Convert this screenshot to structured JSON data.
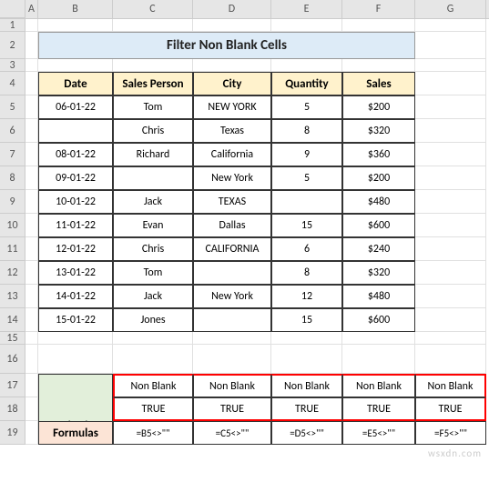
{
  "columns": [
    "A",
    "B",
    "C",
    "D",
    "E",
    "F",
    "G"
  ],
  "rowNumbers": [
    1,
    2,
    3,
    4,
    5,
    6,
    7,
    8,
    9,
    10,
    11,
    12,
    13,
    14,
    15,
    16,
    17,
    18,
    19
  ],
  "title": "Filter Non Blank Cells",
  "headers": [
    "Date",
    "Sales Person",
    "City",
    "Quantity",
    "Sales"
  ],
  "data": [
    [
      "06-01-22",
      "Tom",
      "NEW YORK",
      "5",
      "$200"
    ],
    [
      "",
      "Chris",
      "Texas",
      "8",
      "$320"
    ],
    [
      "08-01-22",
      "Richard",
      "California",
      "9",
      "$360"
    ],
    [
      "09-01-22",
      "",
      "New York",
      "5",
      "$200"
    ],
    [
      "10-01-22",
      "Jack",
      "TEXAS",
      "",
      "$480"
    ],
    [
      "11-01-22",
      "Evan",
      "Dallas",
      "15",
      "$600"
    ],
    [
      "12-01-22",
      "Chris",
      "CALIFORNIA",
      "6",
      "$240"
    ],
    [
      "13-01-22",
      "Tom",
      "",
      "8",
      "$320"
    ],
    [
      "14-01-22",
      "Jack",
      "New York",
      "12",
      "$480"
    ],
    [
      "15-01-22",
      "Jones",
      "",
      "15",
      "$600"
    ]
  ],
  "criteria": {
    "label": "Criteria",
    "headers": [
      "Non Blank",
      "Non Blank",
      "Non Blank",
      "Non Blank",
      "Non Blank"
    ],
    "values": [
      "TRUE",
      "TRUE",
      "TRUE",
      "TRUE",
      "TRUE"
    ]
  },
  "formulas": {
    "label": "Formulas",
    "values": [
      "=B5<>\"\"",
      "=C5<>\"\"",
      "=D5<>\"\"",
      "=E5<>\"\"",
      "=F5<>\"\""
    ]
  },
  "watermark": "wsxdn.com"
}
